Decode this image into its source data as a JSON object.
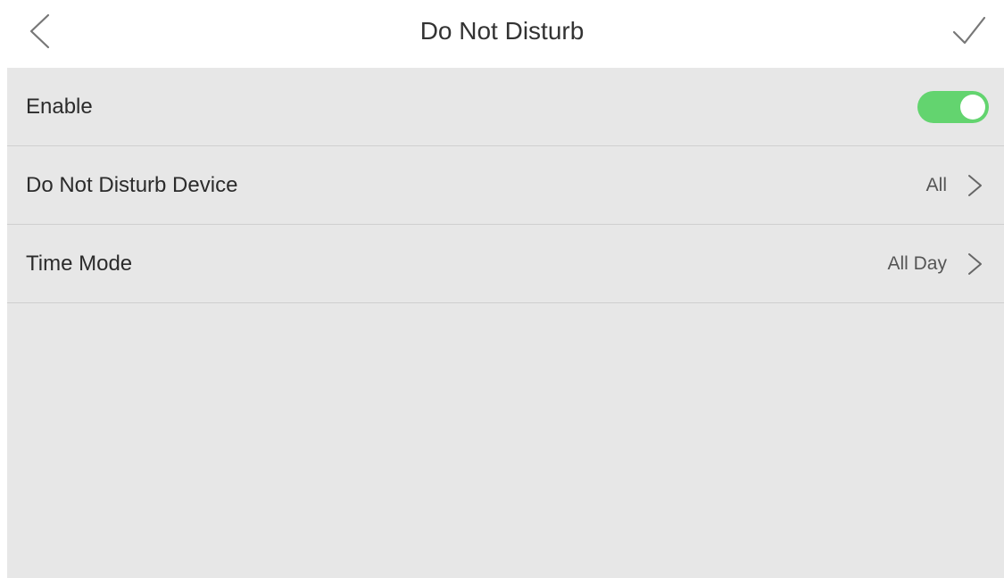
{
  "header": {
    "title": "Do Not Disturb",
    "back_icon": "chevron-left-icon",
    "confirm_icon": "checkmark-icon"
  },
  "settings": {
    "enable": {
      "label": "Enable",
      "toggle_on": true,
      "toggle_color": "#63d46f"
    },
    "device": {
      "label": "Do Not Disturb Device",
      "value": "All"
    },
    "time_mode": {
      "label": "Time Mode",
      "value": "All Day"
    }
  },
  "colors": {
    "panel_background": "#e7e7e7",
    "header_background": "#ffffff",
    "divider": "#cfcfcf"
  }
}
